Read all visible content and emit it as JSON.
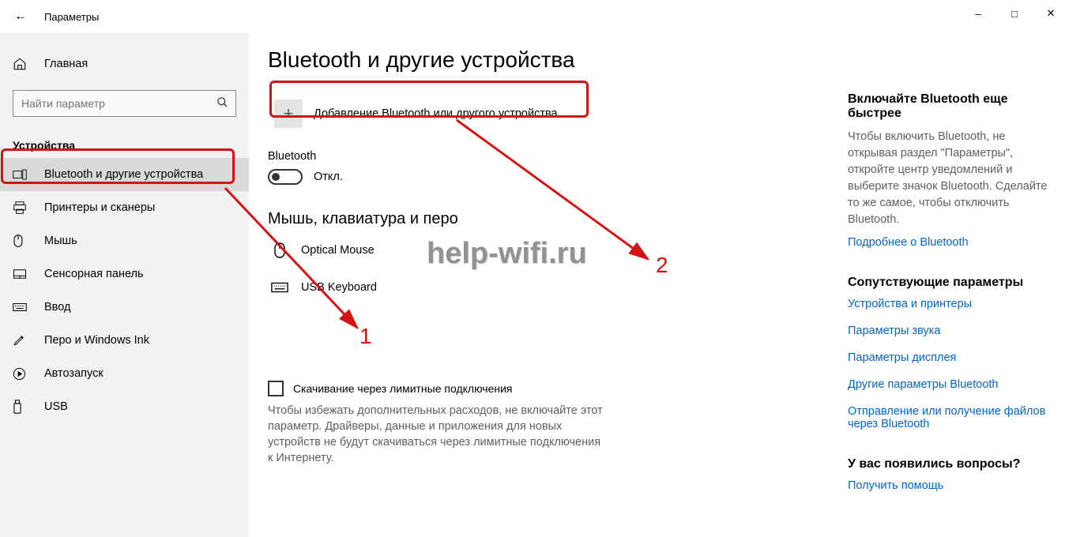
{
  "window": {
    "title": "Параметры"
  },
  "sidebar": {
    "home_label": "Главная",
    "search_placeholder": "Найти параметр",
    "section_header": "Устройства",
    "items": [
      {
        "label": "Bluetooth и другие устройства"
      },
      {
        "label": "Принтеры и сканеры"
      },
      {
        "label": "Мышь"
      },
      {
        "label": "Сенсорная панель"
      },
      {
        "label": "Ввод"
      },
      {
        "label": "Перо и Windows Ink"
      },
      {
        "label": "Автозапуск"
      },
      {
        "label": "USB"
      }
    ]
  },
  "main": {
    "title": "Bluetooth и другие устройства",
    "add_device_label": "Добавление Bluetooth или другого устройства",
    "bluetooth_label": "Bluetooth",
    "toggle_off_text": "Откл.",
    "group_heading": "Мышь, клавиатура и перо",
    "devices": [
      {
        "name": "Optical Mouse"
      },
      {
        "name": "USB Keyboard"
      }
    ],
    "checkbox_label": "Скачивание через лимитные подключения",
    "checkbox_desc": "Чтобы избежать дополнительных расходов, не включайте этот параметр. Драйверы, данные и приложения для новых устройств не будут скачиваться через лимитные подключения к Интернету."
  },
  "right": {
    "block1_heading": "Включайте Bluetooth еще быстрее",
    "block1_text": "Чтобы включить Bluetooth, не открывая раздел \"Параметры\", откройте центр уведомлений и выберите значок Bluetooth. Сделайте то же самое, чтобы отключить Bluetooth.",
    "block1_link": "Подробнее о Bluetooth",
    "block2_heading": "Сопутствующие параметры",
    "block2_links": [
      "Устройства и принтеры",
      "Параметры звука",
      "Параметры дисплея",
      "Другие параметры Bluetooth",
      "Отправление или получение файлов через Bluetooth"
    ],
    "block3_heading": "У вас появились вопросы?",
    "block3_link": "Получить помощь"
  },
  "annotations": {
    "watermark": "help-wifi.ru",
    "label1": "1",
    "label2": "2"
  }
}
